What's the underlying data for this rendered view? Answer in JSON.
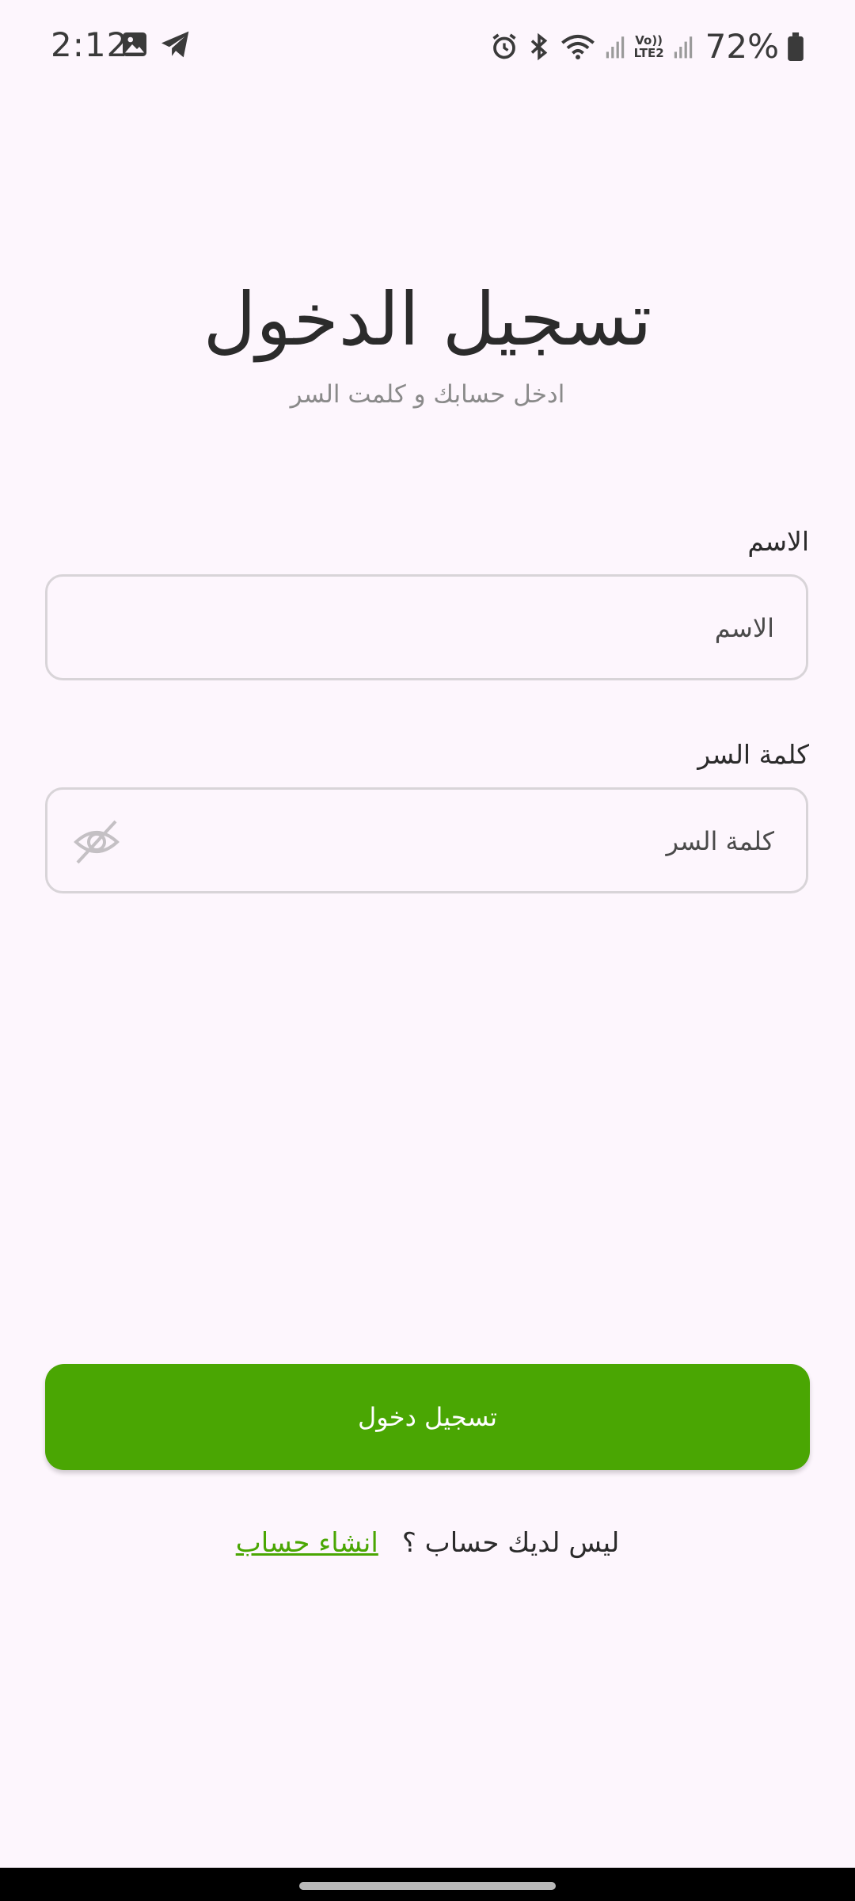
{
  "status_bar": {
    "time": "2:12",
    "battery": "72%",
    "network_label_top": "Vo))",
    "network_label_bottom": "LTE2",
    "icons": [
      "gallery-icon",
      "telegram-icon",
      "alarm-icon",
      "bluetooth-icon",
      "wifi-icon",
      "signal-icon",
      "battery-icon"
    ]
  },
  "login": {
    "title": "تسجيل الدخول",
    "subtitle": "ادخل حسابك و كلمت السر",
    "name_field": {
      "label": "الاسم",
      "placeholder": "الاسم",
      "value": ""
    },
    "password_field": {
      "label": "كلمة السر",
      "placeholder": "كلمة السر",
      "value": ""
    },
    "submit_label": "تسجيل دخول",
    "signup_question": "ليس لديك حساب ؟",
    "signup_link": "انشاء حساب"
  },
  "colors": {
    "accent": "#4aa603",
    "background": "#fdf6fd",
    "field_border": "#d8d4d8"
  }
}
